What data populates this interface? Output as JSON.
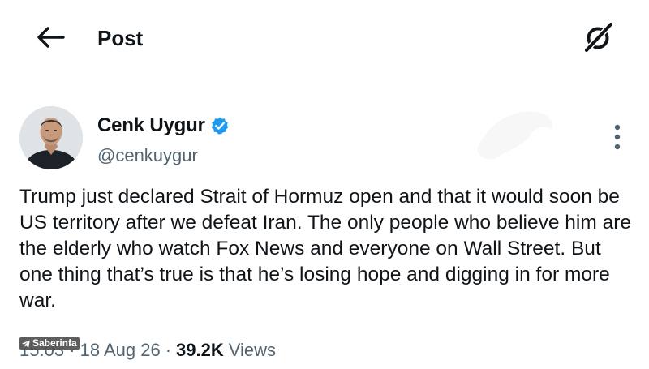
{
  "header": {
    "title": "Post",
    "back_icon": "arrow-left-icon",
    "grok_icon": "grok-icon"
  },
  "tweet": {
    "author": {
      "name": "Cenk Uygur",
      "handle": "@cenkuygur",
      "verified": true,
      "verified_color": "#1d9bf0"
    },
    "text": "Trump just declared Strait of Hormuz open and that it would soon be US territory after we defeat Iran. The only people who believe him are the elderly who watch Fox News and everyone on Wall Street. But one thing that’s true is that he’s losing hope and digging in for more war.",
    "time": "15:03 · 18 Aug 26",
    "views_count": "39.2K",
    "views_label": "Views"
  },
  "watermark": {
    "label": "Saberinfa",
    "icon": "telegram-icon"
  }
}
